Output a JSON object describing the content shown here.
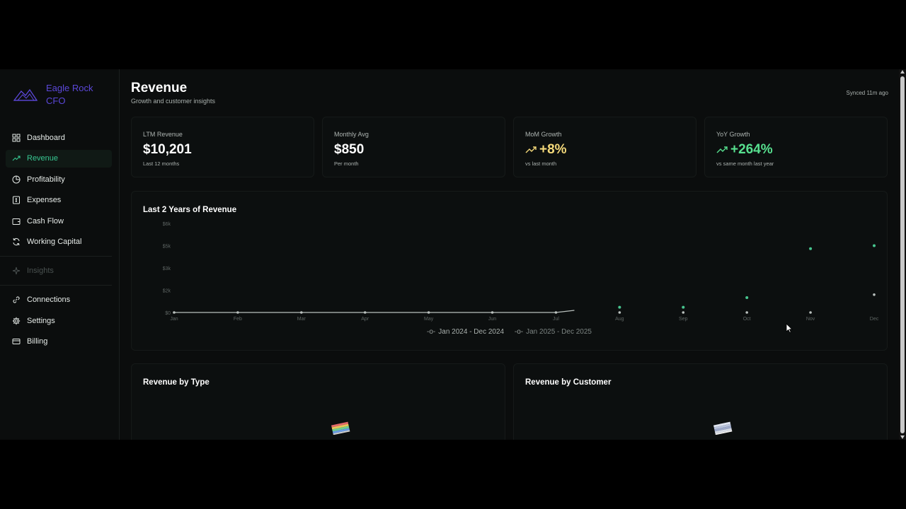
{
  "brand": {
    "name": "Eagle Rock CFO",
    "logo_icon": "mountain-logo-icon",
    "color": "#5b47d8"
  },
  "sidebar": {
    "items": [
      {
        "label": "Dashboard",
        "icon": "grid-icon"
      },
      {
        "label": "Revenue",
        "icon": "trending-up-icon",
        "active": true
      },
      {
        "label": "Profitability",
        "icon": "pie-icon"
      },
      {
        "label": "Expenses",
        "icon": "receipt-icon"
      },
      {
        "label": "Cash Flow",
        "icon": "wallet-icon"
      },
      {
        "label": "Working Capital",
        "icon": "refresh-icon"
      },
      {
        "label": "Insights",
        "icon": "sparkles-icon",
        "disabled": true
      },
      {
        "label": "Connections",
        "icon": "link-icon"
      },
      {
        "label": "Settings",
        "icon": "gear-icon"
      },
      {
        "label": "Billing",
        "icon": "credit-card-icon"
      }
    ]
  },
  "header": {
    "title": "Revenue",
    "subtitle": "Growth and customer insights",
    "synced": "Synced 11m ago"
  },
  "kpis": [
    {
      "label": "LTM Revenue",
      "value": "$10,201",
      "sub": "Last 12 months"
    },
    {
      "label": "Monthly Avg",
      "value": "$850",
      "sub": "Per month"
    },
    {
      "label": "MoM Growth",
      "value": "+8%",
      "sub": "vs last month",
      "icon": "trending-up-icon",
      "color": "#f4d97a"
    },
    {
      "label": "YoY Growth",
      "value": "+264%",
      "sub": "vs same month last year",
      "icon": "trending-up-icon",
      "color": "#57e08f"
    }
  ],
  "colors": {
    "accent": "#37c892",
    "point": "#47c58f",
    "line": "#b9c0bd"
  },
  "chart_data": {
    "type": "line",
    "title": "Last 2 Years of Revenue",
    "categories": [
      "Jan",
      "Feb",
      "Mar",
      "Apr",
      "May",
      "Jun",
      "Jul",
      "Aug",
      "Sep",
      "Oct",
      "Nov",
      "Dec"
    ],
    "y_ticks": [
      "$0",
      "$2k",
      "$3k",
      "$5k",
      "$6k"
    ],
    "ylim": [
      0,
      6000
    ],
    "series": [
      {
        "name": "Jan 2024 - Dec 2024",
        "values": [
          0,
          0,
          0,
          0,
          0,
          0,
          0,
          0,
          0,
          0,
          0,
          1200
        ]
      },
      {
        "name": "Jan 2025 - Dec 2025",
        "values": [
          null,
          null,
          null,
          null,
          null,
          null,
          null,
          350,
          350,
          1000,
          4300,
          4500
        ]
      }
    ],
    "grid": false,
    "legend": "bottom"
  },
  "panels": {
    "by_type": {
      "title": "Revenue by Type"
    },
    "by_customer": {
      "title": "Revenue by Customer"
    }
  }
}
